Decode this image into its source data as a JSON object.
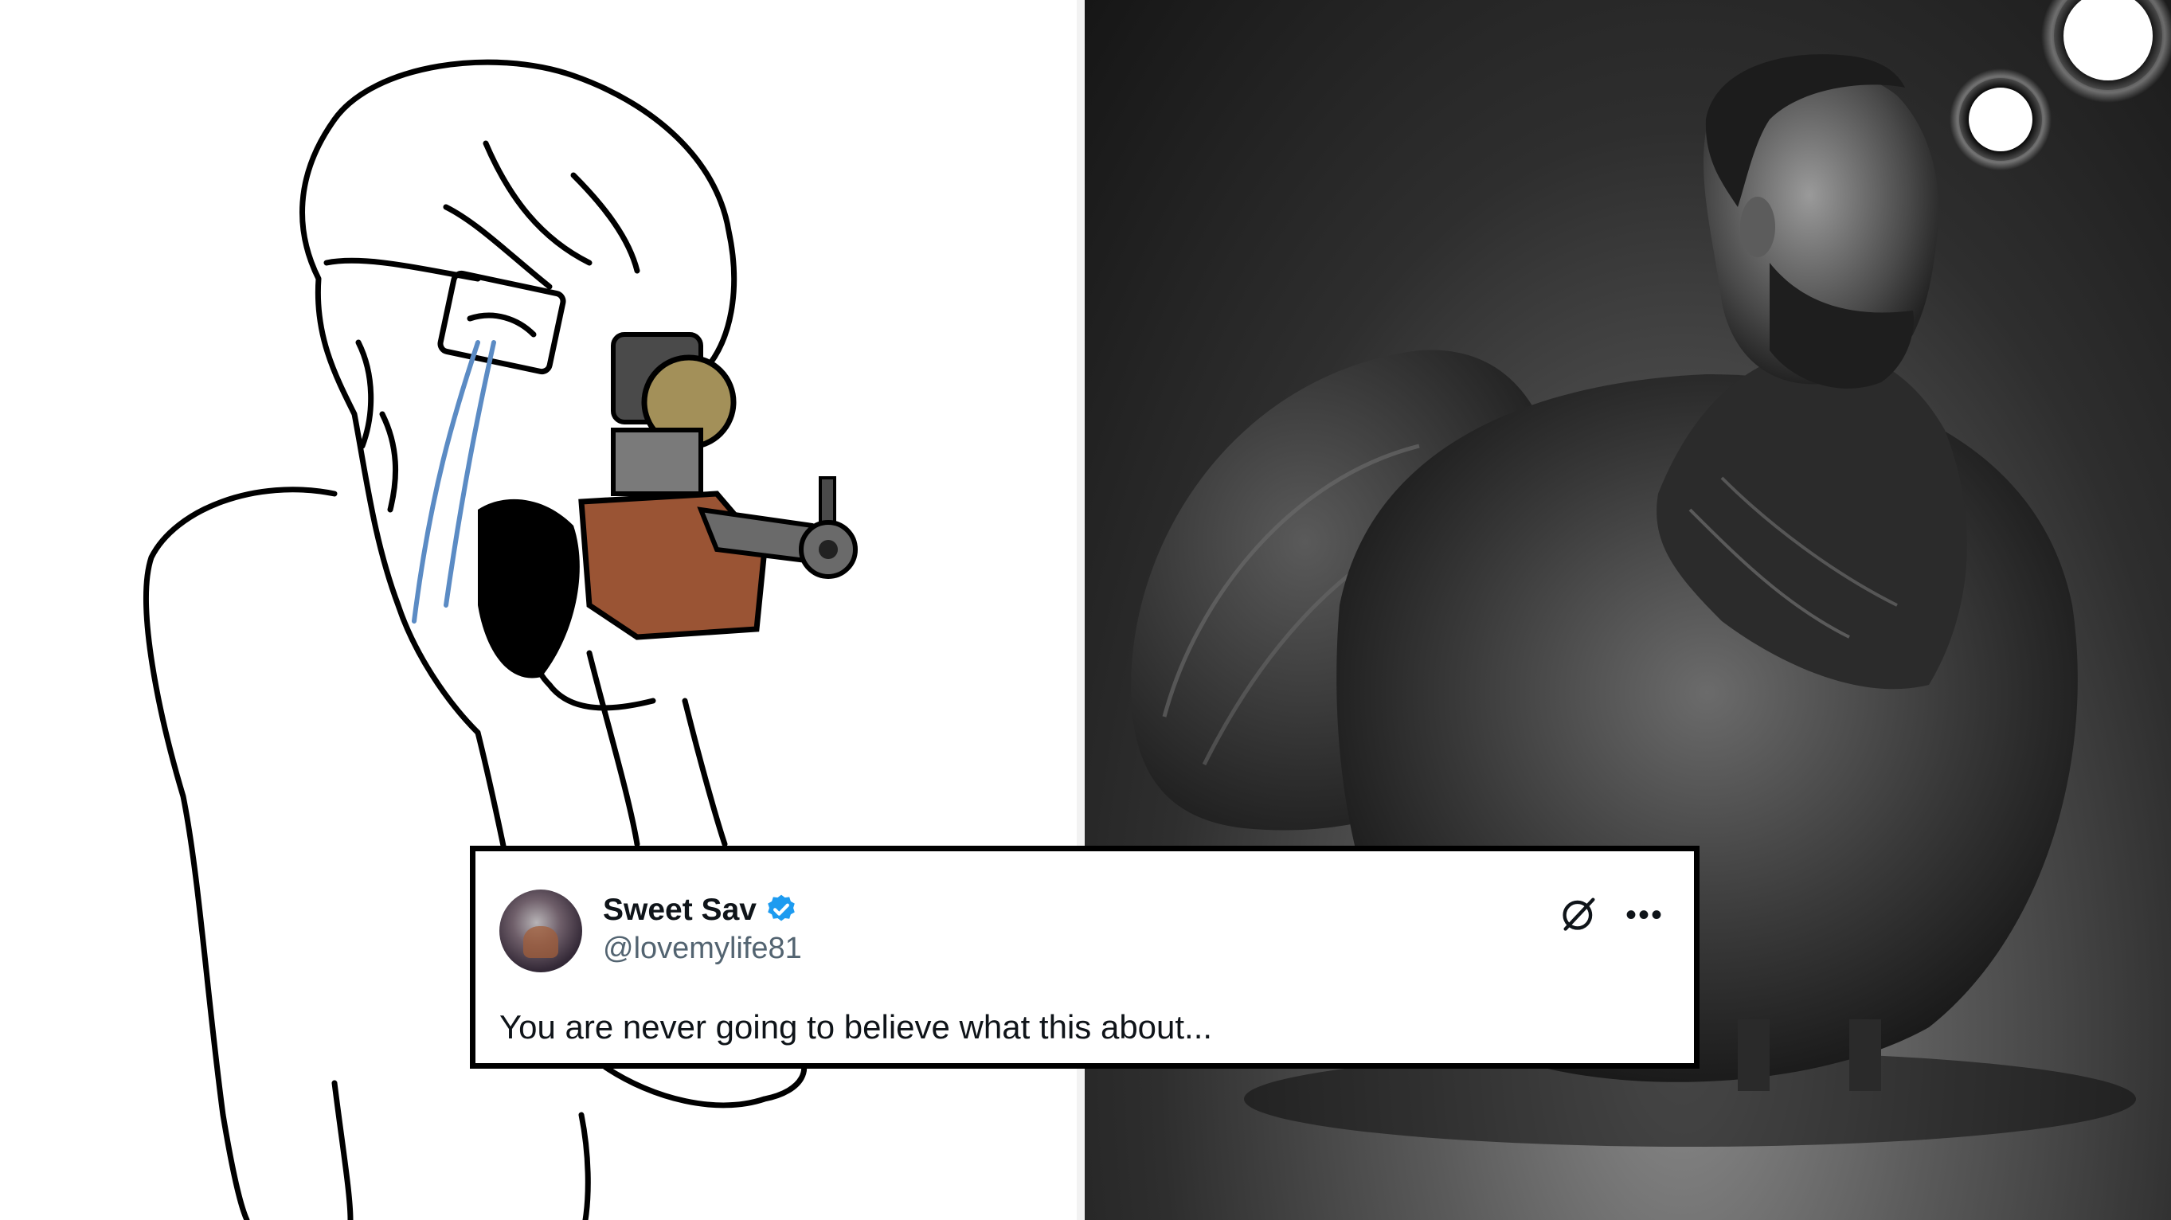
{
  "tweet": {
    "display_name": "Sweet Sav",
    "handle": "@lovemylife81",
    "verified": true,
    "verified_color": "#1d9bf0",
    "text": "You are never going to believe what this about...",
    "icons": [
      "grok-icon",
      "more-icon"
    ]
  },
  "meme": {
    "left_panel": "wojak-crying-with-rifle-illustration",
    "right_panel": "chad-head-on-rooster-photo"
  }
}
